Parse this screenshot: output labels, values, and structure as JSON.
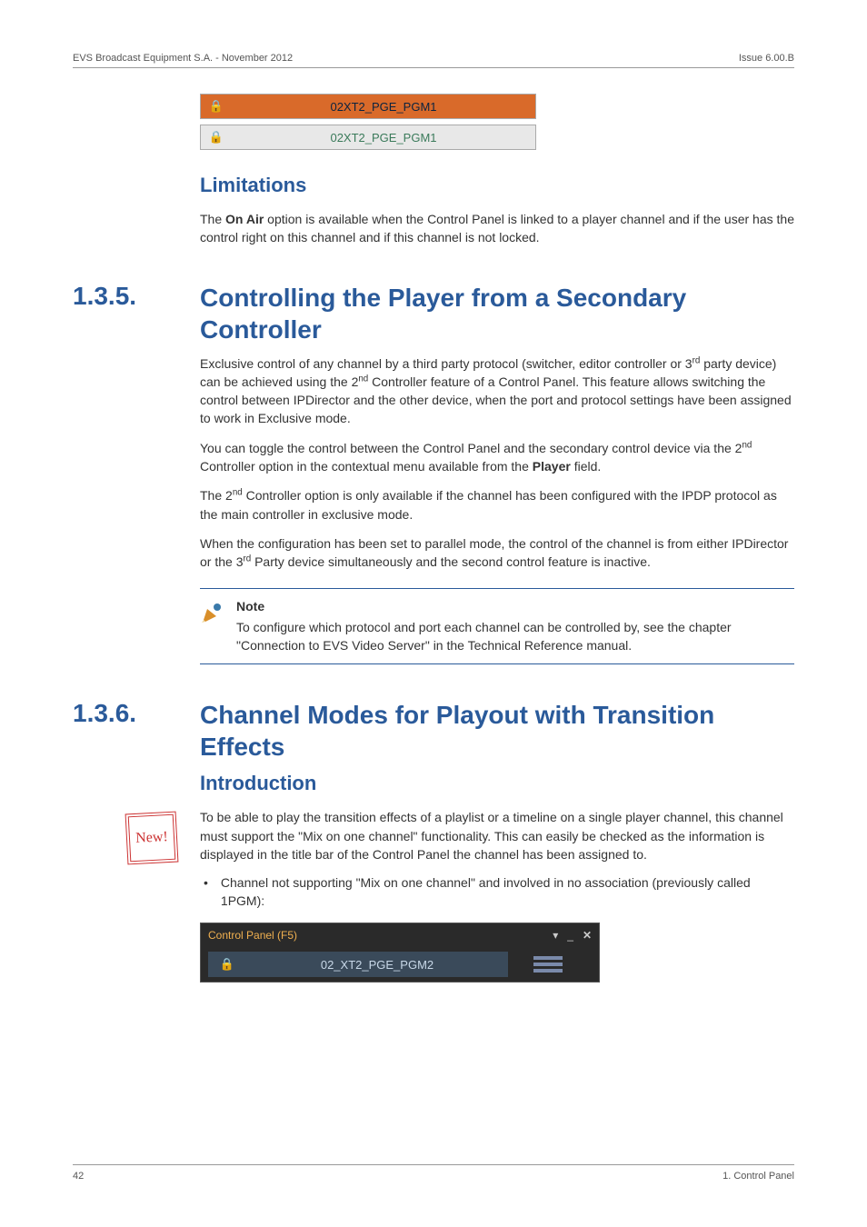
{
  "header": {
    "left": "EVS Broadcast Equipment S.A.  - November 2012",
    "right": "Issue 6.00.B"
  },
  "img_channels": {
    "row1": "02XT2_PGE_PGM1",
    "row2": "02XT2_PGE_PGM1"
  },
  "limitations": {
    "heading": "Limitations",
    "p1_a": "The ",
    "p1_b": "On Air",
    "p1_c": " option is available when the Control Panel is linked to a player channel and if the user has the control right on this channel and if this channel is not locked."
  },
  "sec135": {
    "num": "1.3.5.",
    "title": "Controlling the Player from a Secondary Controller",
    "p1_a": "Exclusive control of any channel by a third party protocol (switcher, editor controller or 3",
    "p1_sup": "rd",
    "p1_b": " party device) can be achieved using the 2",
    "p1_sup2": "nd",
    "p1_c": " Controller feature of a Control Panel. This feature allows switching the control between IPDirector and the other device, when the port and protocol settings have been assigned to work in Exclusive mode.",
    "p2_a": "You can toggle the control between the Control Panel and the secondary control device via the 2",
    "p2_sup": "nd",
    "p2_b": " Controller option in the contextual menu available from the ",
    "p2_bold": "Player",
    "p2_c": " field.",
    "p3_a": "The 2",
    "p3_sup": "nd",
    "p3_b": " Controller option is only available if the channel has been configured with the IPDP protocol as the main controller in exclusive mode.",
    "p4_a": "When the configuration has been set to parallel mode, the control of the channel is from either IPDirector or the 3",
    "p4_sup": "rd",
    "p4_b": " Party device simultaneously and the second control feature is inactive.",
    "note_label": "Note",
    "note_text": "To configure which protocol and port each channel can be controlled by, see the chapter \"Connection to EVS Video Server\" in the Technical Reference manual."
  },
  "sec136": {
    "num": "1.3.6.",
    "title": "Channel Modes for Playout with Transition Effects",
    "intro_heading": "Introduction",
    "new_badge": "New!",
    "p1": "To be able to play the transition effects of a playlist or a timeline on a single player channel, this channel must support the \"Mix on one channel\" functionality. This can easily be checked as the information is displayed in the title bar of the Control Panel the channel has been assigned to.",
    "bullet1": "Channel not supporting \"Mix on one channel\" and involved in no association (previously called 1PGM):",
    "panel_title": "Control Panel (F5)",
    "panel_channel": "02_XT2_PGE_PGM2",
    "panel_close": "✕",
    "panel_min": "_",
    "panel_menu": "▾"
  },
  "footer": {
    "left": "42",
    "right": "1. Control Panel"
  }
}
